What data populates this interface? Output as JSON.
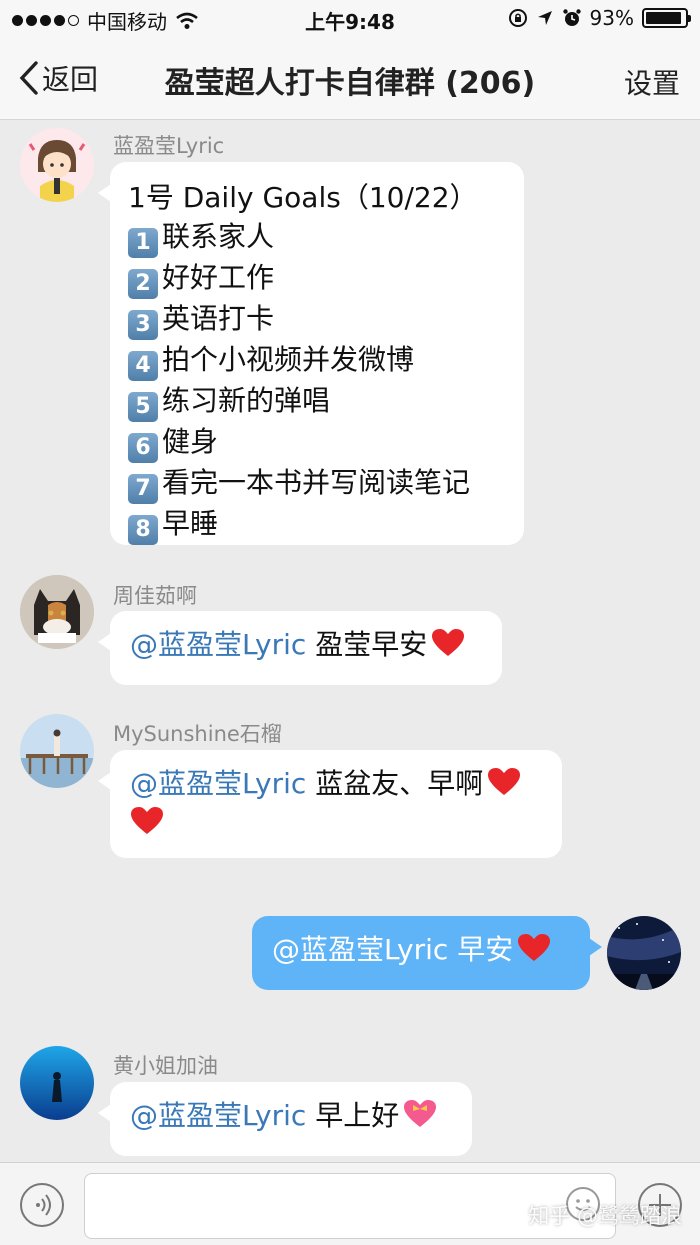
{
  "status_bar": {
    "carrier": "中国移动",
    "time": "上午9:48",
    "battery": "93%",
    "battery_level": 0.93
  },
  "nav": {
    "back_label": "返回",
    "title": "盈莹超人打卡自律群 (206)",
    "settings_label": "设置"
  },
  "messages": [
    {
      "sender": "蓝盈莹Lyric",
      "title": "1号 Daily Goals（10/22）",
      "goals": [
        {
          "num": "1",
          "text": "联系家人"
        },
        {
          "num": "2",
          "text": "好好工作"
        },
        {
          "num": "3",
          "text": "英语打卡"
        },
        {
          "num": "4",
          "text": "拍个小视频并发微博"
        },
        {
          "num": "5",
          "text": "练习新的弹唱"
        },
        {
          "num": "6",
          "text": "健身"
        },
        {
          "num": "7",
          "text": "看完一本书并写阅读笔记"
        },
        {
          "num": "8",
          "text": "早睡"
        }
      ]
    },
    {
      "sender": "周佳茹啊",
      "mention": "@蓝盈莹Lyric",
      "text": " 盈莹早安",
      "emoji": "red-heart"
    },
    {
      "sender": "MySunshine石榴",
      "mention": "@蓝盈莹Lyric",
      "text": " 蓝盆友、早啊",
      "emoji": "red-heart"
    },
    {
      "sender": "",
      "mention": "@蓝盈莹Lyric",
      "text": "  早安",
      "emoji": "red-heart",
      "outgoing": true
    },
    {
      "sender": "黄小姐加油",
      "mention": "@蓝盈莹Lyric",
      "text": " 早上好",
      "emoji": "heart-with-ribbon"
    }
  ],
  "watermark": "知乎 @鹭鸶踏浪",
  "colors": {
    "background": "#ebebeb",
    "outgoing_bubble": "#5fb4f7",
    "mention": "#3a78b8",
    "heart": "#e8262a"
  }
}
